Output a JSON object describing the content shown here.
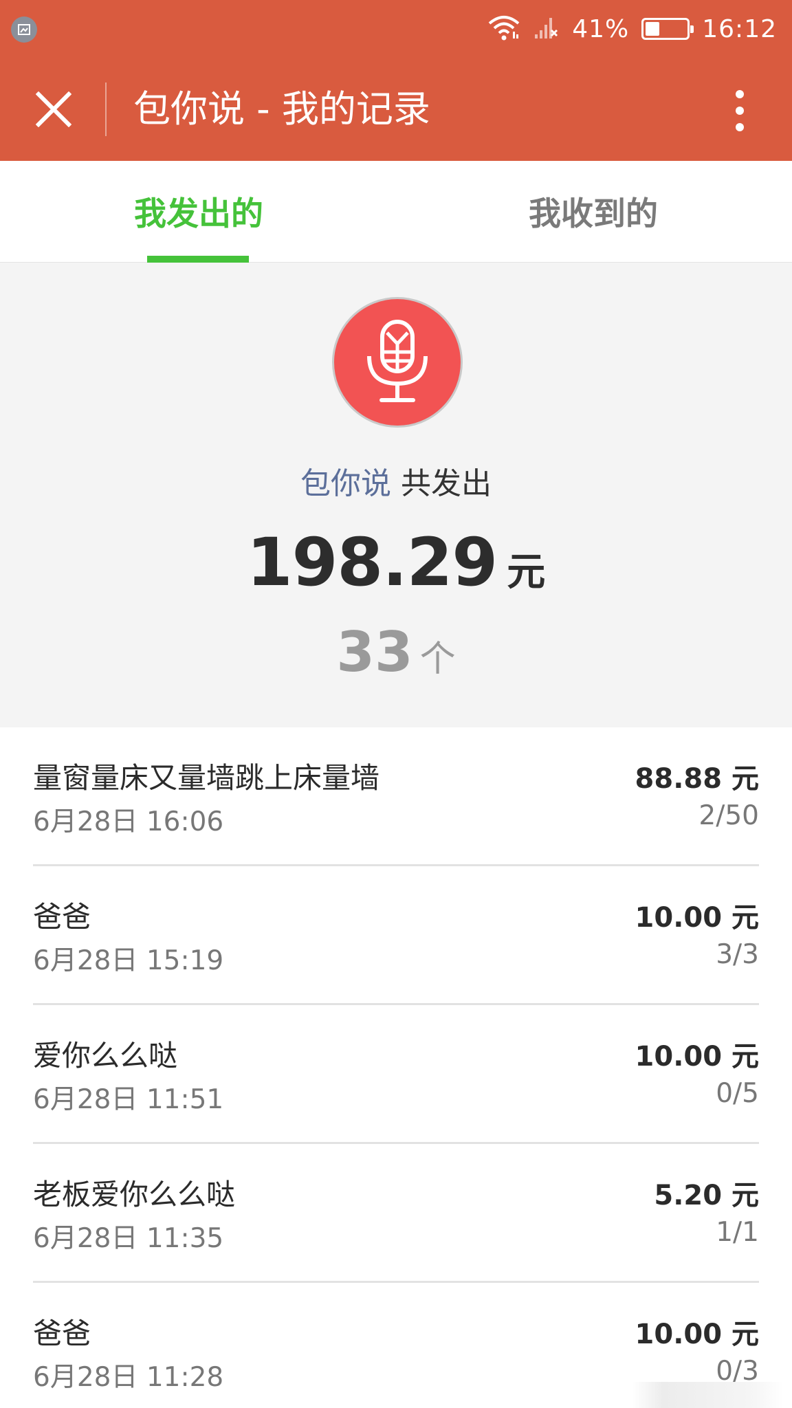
{
  "status_bar": {
    "battery_percent": "41%",
    "battery_level": 0.41,
    "time": "16:12",
    "icons": [
      "screenshot-icon",
      "wifi-icon",
      "signal-icon",
      "battery-icon"
    ]
  },
  "app_bar": {
    "title": "包你说 - 我的记录",
    "close_icon": "close-icon",
    "more_icon": "more-vertical-icon"
  },
  "tabs": [
    {
      "label": "我发出的",
      "active": true
    },
    {
      "label": "我收到的",
      "active": false
    }
  ],
  "colors": {
    "header": "#d95b3f",
    "active_tab": "#45c23a",
    "mic_circle": "#f25353",
    "brand_text": "#5c6f9a"
  },
  "summary": {
    "icon": "microphone-icon",
    "brand": "包你说",
    "label": "共发出",
    "amount": "198.29",
    "amount_unit": "元",
    "count": "33",
    "count_unit": "个"
  },
  "records": [
    {
      "title": "量窗量床又量墙跳上床量墙",
      "time": "6月28日 16:06",
      "amount": "88.88 元",
      "count": "2/50"
    },
    {
      "title": "爸爸",
      "time": "6月28日 15:19",
      "amount": "10.00 元",
      "count": "3/3"
    },
    {
      "title": "爱你么么哒",
      "time": "6月28日 11:51",
      "amount": "10.00 元",
      "count": "0/5"
    },
    {
      "title": "老板爱你么么哒",
      "time": "6月28日 11:35",
      "amount": "5.20 元",
      "count": "1/1"
    },
    {
      "title": "爸爸",
      "time": "6月28日 11:28",
      "amount": "10.00 元",
      "count": "0/3"
    }
  ]
}
